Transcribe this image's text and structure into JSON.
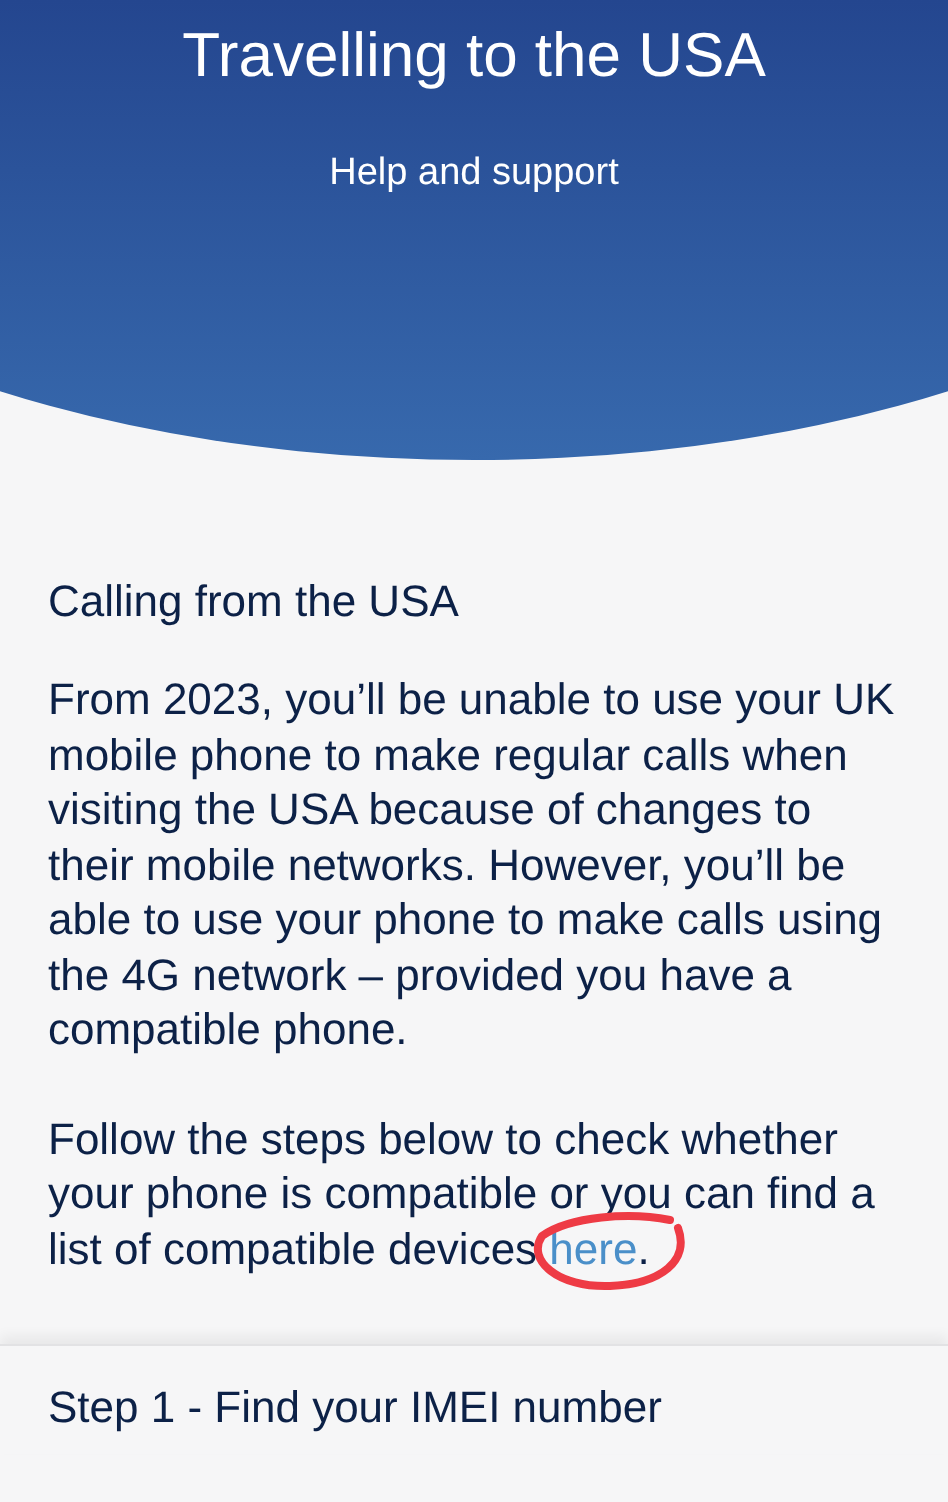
{
  "header": {
    "title": "Travelling to the USA",
    "subtitle": "Help and support"
  },
  "section": {
    "heading": "Calling from the USA",
    "paragraphs": [
      "From 2023, you’ll be unable to use your UK mobile phone to make regular calls when visiting the USA because of changes to their mobile networks. However, you’ll be able to use your phone to make calls using the 4G network – provided you have a compatible phone."
    ],
    "link_paragraph": {
      "text": "Follow the steps below to check whether your phone is compatible or you can find a list of compatible devices ",
      "link": "here",
      "after": "."
    }
  },
  "next_section": {
    "heading": "Step 1 - Find your IMEI number"
  }
}
